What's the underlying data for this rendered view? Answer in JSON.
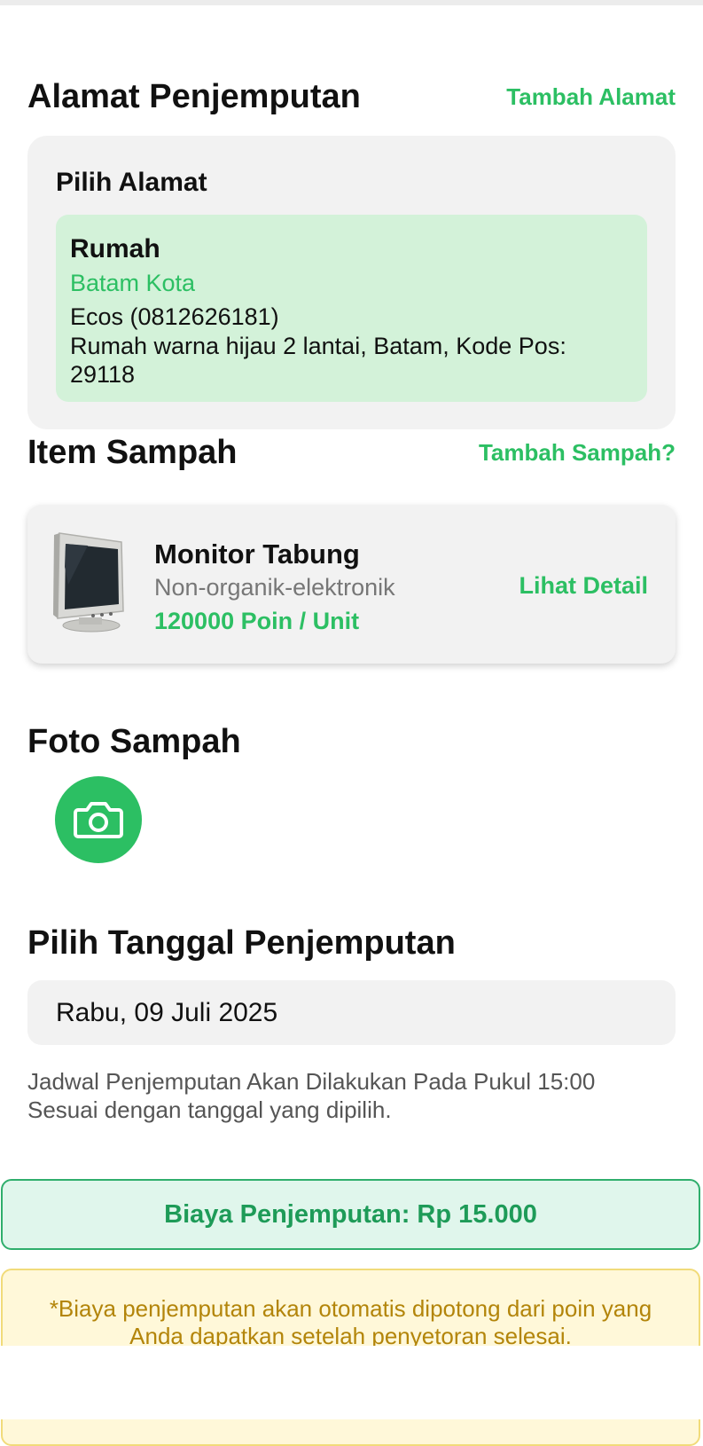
{
  "address_section": {
    "title": "Alamat Penjemputan",
    "add_link": "Tambah Alamat",
    "card_title": "Pilih Alamat",
    "selected": {
      "name": "Rumah",
      "city": "Batam Kota",
      "contact": "Ecos (0812626181)",
      "detail": "Rumah warna hijau 2 lantai, Batam, Kode Pos: 29118"
    }
  },
  "items_section": {
    "title": "Item Sampah",
    "add_link": "Tambah Sampah?",
    "items": [
      {
        "name": "Monitor Tabung",
        "category": "Non-organik-elektronik",
        "price": "120000 Poin / Unit",
        "detail_link": "Lihat Detail",
        "image_icon": "crt-monitor-image"
      }
    ]
  },
  "photo_section": {
    "title": "Foto Sampah",
    "camera_icon": "camera-icon"
  },
  "date_section": {
    "title": "Pilih Tanggal Penjemputan",
    "selected_date": "Rabu, 09 Juli 2025",
    "note_line1": "Jadwal Penjemputan Akan Dilakukan Pada Pukul 15:00",
    "note_line2": "Sesuai dengan tanggal yang dipilih."
  },
  "fee": {
    "text": "Biaya Penjemputan: Rp 15.000"
  },
  "warning": {
    "line1": "*Biaya penjemputan akan otomatis dipotong dari poin yang",
    "line2": "Anda dapatkan setelah penyetoran selesai."
  },
  "colors": {
    "accent": "#2cbf63",
    "selected_address_bg": "#d3f2d9",
    "card_bg": "#f2f2f2",
    "fee_bg": "#e0f6ec",
    "warning_bg": "#fff8d9",
    "warning_text": "#b3850a"
  }
}
